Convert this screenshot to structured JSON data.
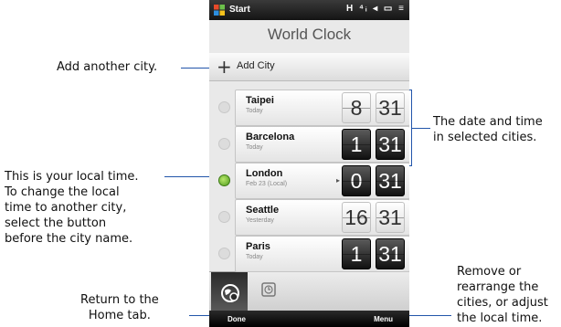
{
  "statusbar": {
    "start_label": "Start",
    "status_icons": "H ⁴ᵢ ◂ ▭ ≡"
  },
  "app": {
    "title": "World Clock"
  },
  "add_city": {
    "label": "Add City"
  },
  "cities": [
    {
      "name": "Taipei",
      "date": "Today",
      "hour": "8",
      "minute": "31",
      "night": false,
      "local": false
    },
    {
      "name": "Barcelona",
      "date": "Today",
      "hour": "1",
      "minute": "31",
      "night": true,
      "local": false
    },
    {
      "name": "London",
      "date": "Feb 23  (Local)",
      "hour": "0",
      "minute": "31",
      "night": true,
      "local": true
    },
    {
      "name": "Seattle",
      "date": "Yesterday",
      "hour": "16",
      "minute": "31",
      "night": false,
      "local": false
    },
    {
      "name": "Paris",
      "date": "Today",
      "hour": "1",
      "minute": "31",
      "night": true,
      "local": false
    }
  ],
  "softkeys": {
    "left": "Done",
    "right": "Menu"
  },
  "annotations": {
    "add_city": "Add another city.",
    "date_time": [
      "The date and time",
      "in selected cities."
    ],
    "local_time": [
      "This is your local time.",
      "To change the local",
      "time to another city,",
      "select the button",
      "before the city name."
    ],
    "remove": [
      "Remove or",
      "rearrange the",
      "cities, or adjust",
      "the local time."
    ],
    "home_tab": [
      "Return to the",
      "Home tab."
    ]
  },
  "colors": {
    "annotation_line": "#2255aa",
    "local_radio": "#4f9a1e"
  }
}
